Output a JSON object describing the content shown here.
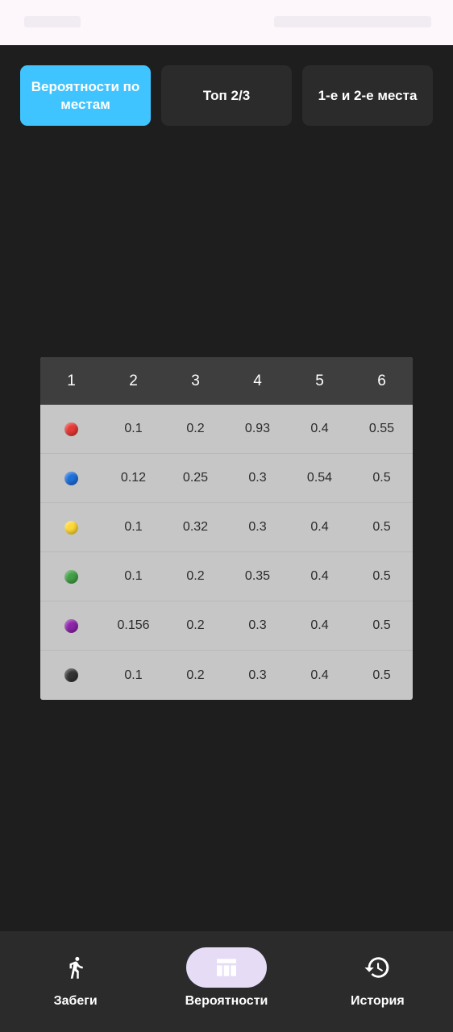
{
  "tabs": [
    {
      "label": "Вероятности по местам",
      "active": true
    },
    {
      "label": "Топ 2/3",
      "active": false
    },
    {
      "label": "1-е и 2-е места",
      "active": false
    }
  ],
  "table": {
    "headers": [
      "1",
      "2",
      "3",
      "4",
      "5",
      "6"
    ],
    "rows": [
      {
        "color": "#e53935",
        "color_name": "red",
        "values": [
          "0.1",
          "0.2",
          "0.93",
          "0.4",
          "0.55"
        ]
      },
      {
        "color": "#1e6fd9",
        "color_name": "blue",
        "values": [
          "0.12",
          "0.25",
          "0.3",
          "0.54",
          "0.5"
        ]
      },
      {
        "color": "#fdd835",
        "color_name": "yellow",
        "values": [
          "0.1",
          "0.32",
          "0.3",
          "0.4",
          "0.5"
        ]
      },
      {
        "color": "#43a047",
        "color_name": "green",
        "values": [
          "0.1",
          "0.2",
          "0.35",
          "0.4",
          "0.5"
        ]
      },
      {
        "color": "#8e24aa",
        "color_name": "purple",
        "values": [
          "0.156",
          "0.2",
          "0.3",
          "0.4",
          "0.5"
        ]
      },
      {
        "color": "#333333",
        "color_name": "black",
        "values": [
          "0.1",
          "0.2",
          "0.3",
          "0.4",
          "0.5"
        ]
      }
    ]
  },
  "nav": {
    "items": [
      {
        "label": "Забеги",
        "icon": "running-person-icon",
        "active": false
      },
      {
        "label": "Вероятности",
        "icon": "table-icon",
        "active": true
      },
      {
        "label": "История",
        "icon": "history-icon",
        "active": false
      }
    ]
  },
  "colors": {
    "accent": "#40c4ff",
    "background": "#1e1e1e",
    "nav_active_pill": "#e6dcf6"
  }
}
